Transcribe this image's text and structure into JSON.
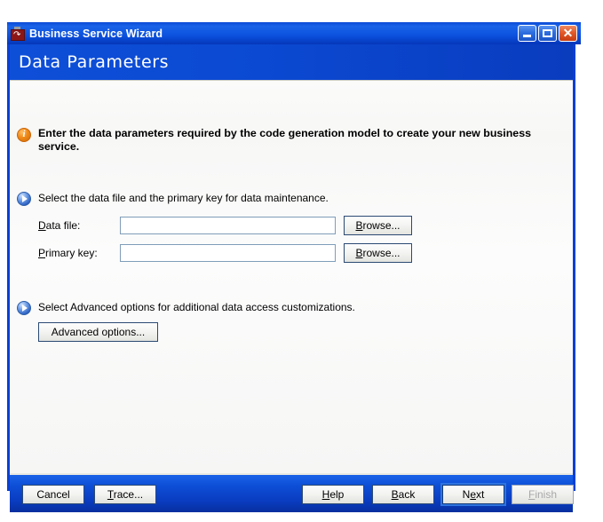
{
  "window": {
    "title": "Business Service Wizard",
    "icon": "wizard-app-icon",
    "controls": {
      "minimize": "minimize-icon",
      "maximize": "maximize-icon",
      "close": "close-icon",
      "close_glyph": "✕"
    }
  },
  "banner": {
    "title": "Data Parameters"
  },
  "info": {
    "icon": "info-icon",
    "text": "Enter the data parameters required by the code generation model to create your new business service."
  },
  "steps": [
    {
      "icon": "blue-arrow-icon",
      "text": "Select the data file and the primary key for data maintenance."
    },
    {
      "icon": "blue-arrow-icon",
      "text": "Select Advanced options for  additional data access customizations."
    }
  ],
  "fields": {
    "data_file": {
      "label_pre": "",
      "label_accel": "D",
      "label_post": "ata file:",
      "value": "",
      "placeholder": "",
      "browse_label_accel": "B",
      "browse_label_post": "rowse..."
    },
    "primary_key": {
      "label_pre": "",
      "label_accel": "P",
      "label_post": "rimary key:",
      "value": "",
      "placeholder": "",
      "browse_label_accel": "B",
      "browse_label_post": "rowse..."
    }
  },
  "advanced_button": {
    "label": "Advanced options..."
  },
  "footer": {
    "cancel": {
      "label": "Cancel",
      "state": "enabled"
    },
    "trace": {
      "accel": "T",
      "label_post": "race...",
      "state": "enabled"
    },
    "help": {
      "pre": "H",
      "accel": "H",
      "label_post": "elp",
      "state": "enabled"
    },
    "back": {
      "accel": "B",
      "label_post": "ack",
      "state": "enabled"
    },
    "next": {
      "pre": "N",
      "accel": "e",
      "label_post": "xt",
      "state": "focused"
    },
    "finish": {
      "accel": "F",
      "label_post": "inish",
      "state": "disabled"
    }
  },
  "colors": {
    "title_blue": "#0a49d6",
    "banner_blue": "#0e4fd8",
    "frame_blue": "#0a3fd6",
    "info_orange": "#f08a18",
    "step_blue": "#2e62c4",
    "input_border": "#7f9db9",
    "content_bg": "#fbfbfa"
  }
}
